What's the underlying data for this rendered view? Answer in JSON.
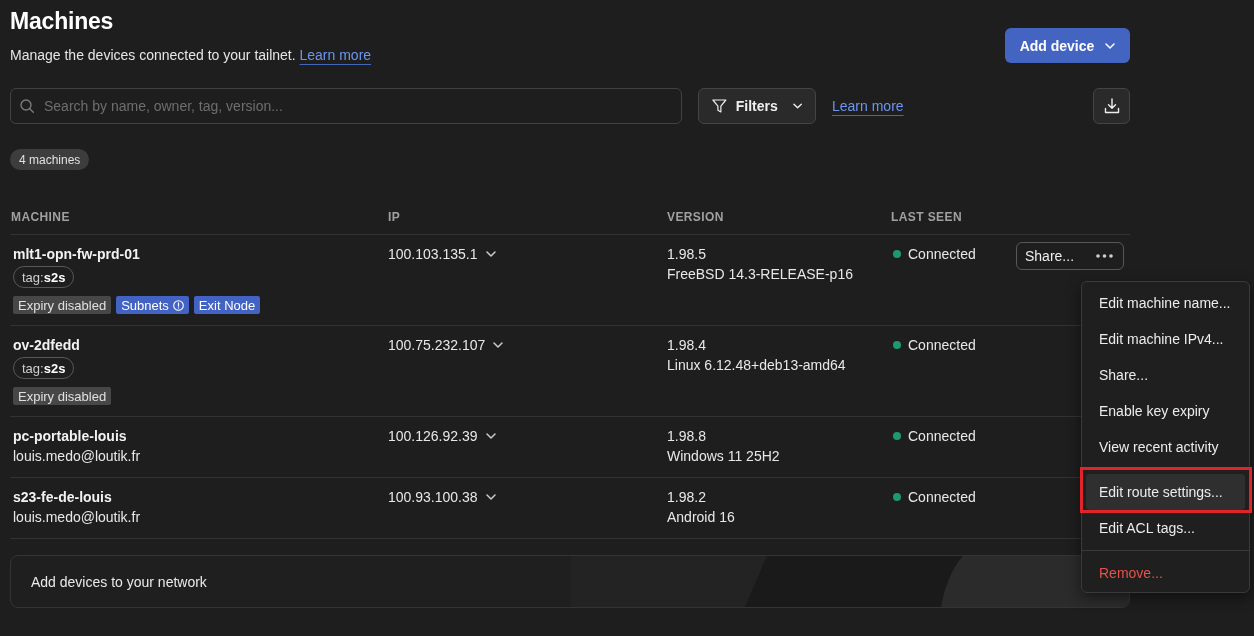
{
  "header": {
    "title": "Machines",
    "description": "Manage the devices connected to your tailnet.",
    "learn_more": "Learn more",
    "add_button": "Add device"
  },
  "toolbar": {
    "search": {
      "placeholder": "Search by name, owner, tag, version..."
    },
    "filters_button": "Filters",
    "learn_more": "Learn more"
  },
  "machine_count": "4 machines",
  "table": {
    "columns": [
      "MACHINE",
      "IP",
      "VERSION",
      "LAST SEEN"
    ],
    "rows": [
      {
        "name": "mlt1-opn-fw-prd-01",
        "tags": [
          "tag:**s2s**"
        ],
        "badges": [
          {
            "text": "Expiry disabled",
            "kind": "neutral",
            "info_icon": false
          },
          {
            "text": "Subnets",
            "kind": "accent",
            "info_icon": true
          },
          {
            "text": "Exit Node",
            "kind": "accent",
            "info_icon": false
          }
        ],
        "ip": "100.103.135.1",
        "version": "1.98.5",
        "os": "FreeBSD 14.3-RELEASE-p16",
        "status": {
          "text": "Connected",
          "color": "#1d9a6c"
        },
        "share_button": "Share..."
      },
      {
        "name": "ov-2dfedd",
        "tags": [
          "tag:**s2s**"
        ],
        "badges": [
          {
            "text": "Expiry disabled",
            "kind": "neutral",
            "info_icon": false
          }
        ],
        "ip": "100.75.232.107",
        "version": "1.98.4",
        "os": "Linux 6.12.48+deb13-amd64",
        "status": {
          "text": "Connected",
          "color": "#1d9a6c"
        }
      },
      {
        "name": "pc-portable-louis",
        "owner": "louis.medo@loutik.fr",
        "ip": "100.126.92.39",
        "version": "1.98.8",
        "os": "Windows 11 25H2",
        "status": {
          "text": "Connected",
          "color": "#1d9a6c"
        }
      },
      {
        "name": "s23-fe-de-louis",
        "owner": "louis.medo@loutik.fr",
        "ip": "100.93.100.38",
        "version": "1.98.2",
        "os": "Android 16",
        "status": {
          "text": "Connected",
          "color": "#1d9a6c"
        }
      }
    ]
  },
  "context_menu": {
    "groups": [
      {
        "items": [
          {
            "label": "Edit machine name...",
            "kind": "action",
            "selected": false,
            "outlined": false
          },
          {
            "label": "Edit machine IPv4...",
            "kind": "action",
            "selected": false,
            "outlined": false
          },
          {
            "label": "Share...",
            "kind": "action",
            "selected": false,
            "outlined": false
          },
          {
            "label": "Enable key expiry",
            "kind": "action",
            "selected": false,
            "outlined": false
          },
          {
            "label": "View recent activity",
            "kind": "action",
            "selected": false,
            "outlined": false
          }
        ]
      },
      {
        "items": [
          {
            "label": "Edit route settings...",
            "kind": "action",
            "selected": true,
            "outlined": true
          },
          {
            "label": "Edit ACL tags...",
            "kind": "action",
            "selected": false,
            "outlined": false
          }
        ]
      },
      {
        "items": [
          {
            "label": "Remove...",
            "kind": "danger",
            "selected": false,
            "outlined": false
          }
        ]
      }
    ]
  },
  "add_devices_card": {
    "text": "Add devices to your network"
  }
}
